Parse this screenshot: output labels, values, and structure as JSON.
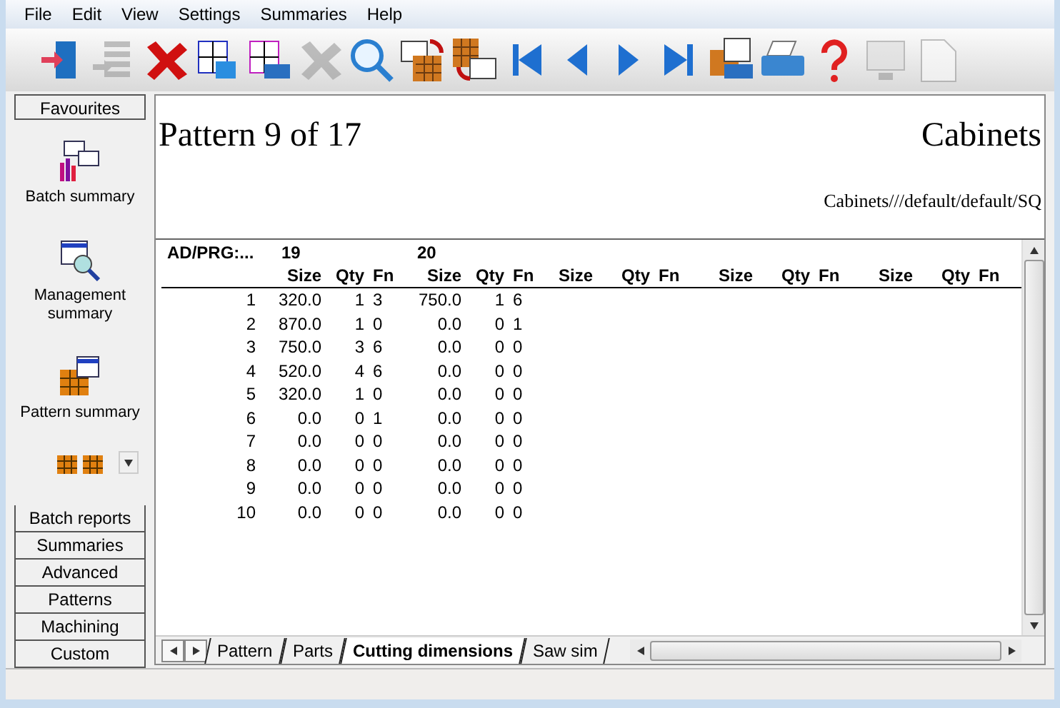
{
  "menu": [
    "File",
    "Edit",
    "View",
    "Settings",
    "Summaries",
    "Help"
  ],
  "toolbar": [
    {
      "kind": "exit",
      "disabled": false
    },
    {
      "kind": "list",
      "disabled": true
    },
    {
      "kind": "delete",
      "disabled": false
    },
    {
      "kind": "table",
      "disabled": false
    },
    {
      "kind": "table-print",
      "disabled": false
    },
    {
      "kind": "tools",
      "disabled": true
    },
    {
      "kind": "search",
      "disabled": false
    },
    {
      "kind": "pattern-back",
      "disabled": false
    },
    {
      "kind": "pattern-forward",
      "disabled": false
    },
    {
      "kind": "first",
      "disabled": false
    },
    {
      "kind": "prev",
      "disabled": false
    },
    {
      "kind": "next",
      "disabled": false
    },
    {
      "kind": "last",
      "disabled": false
    },
    {
      "kind": "pattern-print",
      "disabled": false
    },
    {
      "kind": "print",
      "disabled": false
    },
    {
      "kind": "help",
      "disabled": false
    },
    {
      "kind": "monitor",
      "disabled": true
    },
    {
      "kind": "page",
      "disabled": true
    }
  ],
  "sidebar": {
    "header": "Favourites",
    "items": [
      {
        "kind": "chart",
        "label": "Batch summary"
      },
      {
        "kind": "magnifier",
        "label": "Management summary"
      },
      {
        "kind": "grid",
        "label": "Pattern summary"
      },
      {
        "kind": "more"
      }
    ],
    "groups": [
      "Batch reports",
      "Summaries",
      "Advanced",
      "Patterns",
      "Machining",
      "Custom"
    ]
  },
  "report": {
    "title": "Pattern 9 of 17",
    "company": "Cabinets",
    "path": "Cabinets///default/default/SQ",
    "group_headers": [
      "AD/PRG:...",
      "19",
      "20"
    ],
    "columns": [
      "Size",
      "Qty",
      "Fn",
      "Size",
      "Qty",
      "Fn",
      "Size",
      "Qty",
      "Fn",
      "Size",
      "Qty",
      "Fn",
      "Size",
      "Qty",
      "Fn"
    ],
    "rows": [
      {
        "num": "1",
        "cells": [
          "320.0",
          "1",
          "3",
          "750.0",
          "1",
          "6"
        ]
      },
      {
        "num": "2",
        "cells": [
          "870.0",
          "1",
          "0",
          "0.0",
          "0",
          "1"
        ]
      },
      {
        "num": "3",
        "cells": [
          "750.0",
          "3",
          "6",
          "0.0",
          "0",
          "0"
        ]
      },
      {
        "num": "4",
        "cells": [
          "520.0",
          "4",
          "6",
          "0.0",
          "0",
          "0"
        ]
      },
      {
        "num": "5",
        "cells": [
          "320.0",
          "1",
          "0",
          "0.0",
          "0",
          "0"
        ]
      },
      {
        "num": "6",
        "cells": [
          "0.0",
          "0",
          "1",
          "0.0",
          "0",
          "0"
        ]
      },
      {
        "num": "7",
        "cells": [
          "0.0",
          "0",
          "0",
          "0.0",
          "0",
          "0"
        ]
      },
      {
        "num": "8",
        "cells": [
          "0.0",
          "0",
          "0",
          "0.0",
          "0",
          "0"
        ]
      },
      {
        "num": "9",
        "cells": [
          "0.0",
          "0",
          "0",
          "0.0",
          "0",
          "0"
        ]
      },
      {
        "num": "10",
        "cells": [
          "0.0",
          "0",
          "0",
          "0.0",
          "0",
          "0"
        ]
      }
    ]
  },
  "tabs": [
    {
      "label": "Pattern",
      "selected": false
    },
    {
      "label": "Parts",
      "selected": false
    },
    {
      "label": "Cutting dimensions",
      "selected": true
    },
    {
      "label": "Saw sim",
      "selected": false
    }
  ]
}
